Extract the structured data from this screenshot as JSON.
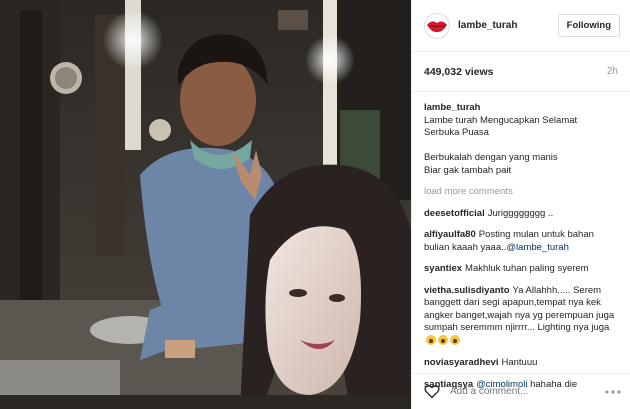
{
  "post": {
    "username": "lambe_turah",
    "follow_label": "Following",
    "views": "449,032 views",
    "time": "2h",
    "caption": {
      "username": "lambe_turah",
      "line1": "Lambe turah Mengucapkan Selamat",
      "line2": "Serbuka Puasa",
      "line3": "Berbukalah dengan yang manis",
      "line4": "Biar gak tambah pait"
    },
    "load_more": "load more comments",
    "comments": [
      {
        "user": "deesetofficial",
        "text": "Jurigggggggg .."
      },
      {
        "user": "alfiyaulfa80",
        "text": "Posting mulan untuk bahan bulian kaaah yaaa..",
        "mention": "@lambe_turah"
      },
      {
        "user": "syantiex",
        "text": "Makhluk tuhan paling syerem"
      },
      {
        "user": "vietha.sulisdiyanto",
        "text": "Ya Allahhh..... Serem banggett dari segi apapun,tempat nya kek angker banget,wajah nya yg perempuan juga sumpah seremmm njirrrr... Lighting nya juga"
      },
      {
        "user": "noviasyaradhevi",
        "text": "Hantuuu"
      },
      {
        "user": "santiaqsya",
        "mention": "@cimolimoli",
        "text": "hahaha die"
      }
    ],
    "add_comment_placeholder": "Add a comment...",
    "icons": {
      "avatar": "lips-icon",
      "like": "heart-icon",
      "more": "more-dots-icon"
    }
  }
}
